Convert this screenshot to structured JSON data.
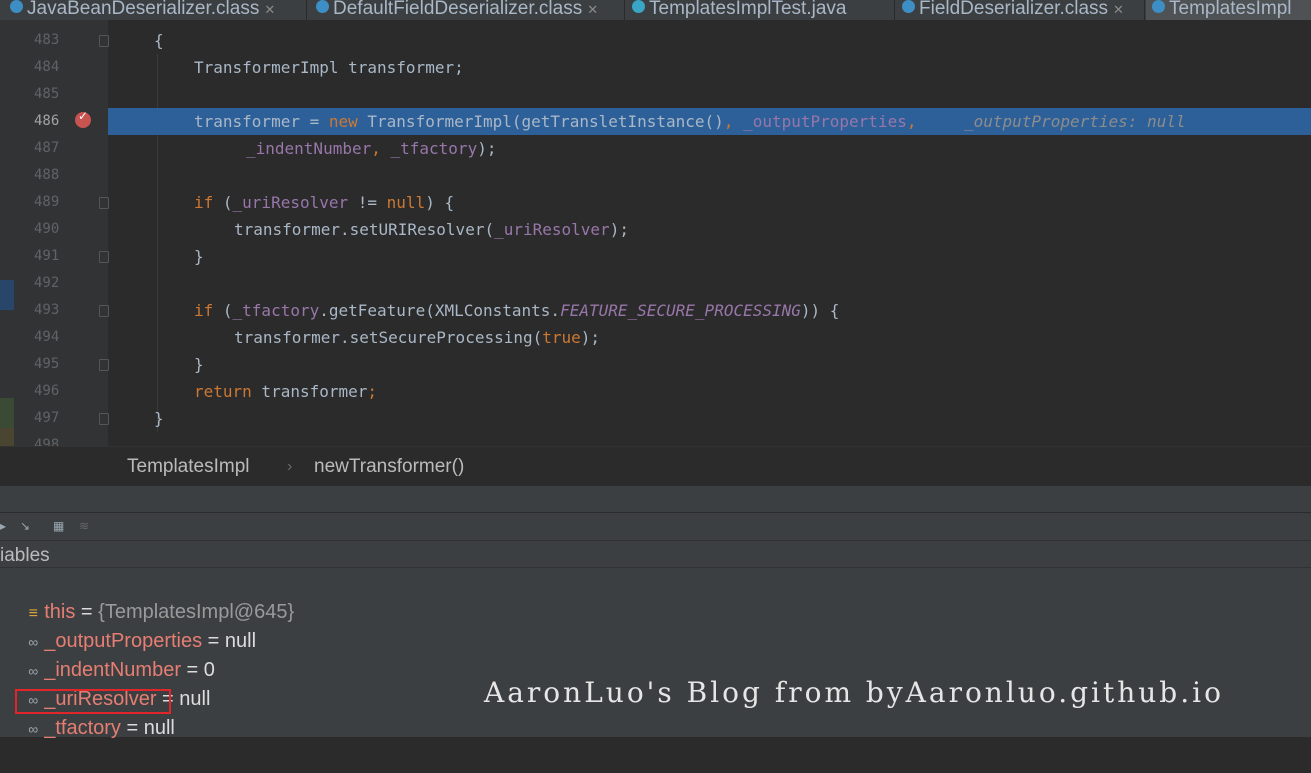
{
  "tabs": [
    {
      "label": "JavaBeanDeserializer.class",
      "type": "class"
    },
    {
      "label": "DefaultFieldDeserializer.class",
      "type": "class"
    },
    {
      "label": "TemplatesImplTest.java",
      "type": "java"
    },
    {
      "label": "FieldDeserializer.class",
      "type": "class"
    },
    {
      "label": "TemplatesImpl",
      "type": "class"
    }
  ],
  "editor": {
    "line_numbers": [
      "483",
      "484",
      "485",
      "486",
      "487",
      "488",
      "489",
      "490",
      "491",
      "492",
      "493",
      "494",
      "495",
      "496",
      "497",
      "498"
    ],
    "code": {
      "l483": "{",
      "l484": "TransformerImpl transformer;",
      "l486_a": "transformer = ",
      "l486_new": "new",
      "l486_b": " TransformerImpl(getTransletInstance()",
      "l486_c": ", ",
      "l486_d": "_outputProperties",
      "l486_e": ",",
      "l486_hint": "_outputProperties: null",
      "l487_a": "_indentNumber",
      "l487_b": ", ",
      "l487_c": "_tfactory",
      "l487_d": ");",
      "l489_if": "if",
      "l489_a": " (",
      "l489_b": "_uriResolver",
      "l489_c": " != ",
      "l489_null": "null",
      "l489_d": ") {",
      "l490_a": "transformer.setURIResolver(",
      "l490_b": "_uriResolver",
      "l490_c": ");",
      "l491": "}",
      "l493_if": "if",
      "l493_a": " (",
      "l493_b": "_tfactory",
      "l493_c": ".getFeature(XMLConstants.",
      "l493_d": "FEATURE_SECURE_PROCESSING",
      "l493_e": ")) {",
      "l494_a": "transformer.setSecureProcessing(",
      "l494_true": "true",
      "l494_b": ");",
      "l495": "}",
      "l496_return": "return",
      "l496_a": " transformer",
      "l496_b": ";",
      "l497": "}"
    }
  },
  "breadcrumb": {
    "class": "TemplatesImpl",
    "sep": "›",
    "method": "newTransformer()"
  },
  "debugger": {
    "variables_label": "iables",
    "variables": [
      {
        "name": "this",
        "value": "{TemplatesImpl@645}",
        "icon": "equals-icon"
      },
      {
        "name": "_outputProperties",
        "value": "null",
        "icon": "glasses-icon"
      },
      {
        "name": "_indentNumber",
        "value": "0",
        "icon": "glasses-icon"
      },
      {
        "name": "_uriResolver",
        "value": "null",
        "icon": "glasses-icon"
      },
      {
        "name": "_tfactory",
        "value": "null",
        "icon": "glasses-icon"
      }
    ]
  },
  "watermark": "AaronLuo's Blog from byAaronluo.github.io",
  "colors": {
    "highlight": "#2d6099",
    "keyword": "#cc7832",
    "field": "#9876aa",
    "annotation_box": "#e0262b"
  }
}
